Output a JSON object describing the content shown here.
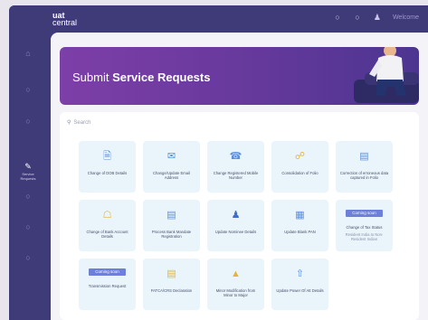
{
  "app": {
    "logo_line1": "uat",
    "logo_line2": "central",
    "user_name": "Welcome"
  },
  "sidebar": {
    "active_label": "Service Requests"
  },
  "banner": {
    "title_prefix": "Submit ",
    "title_bold": "Service Requests"
  },
  "search": {
    "placeholder": "Search"
  },
  "tiles": [
    {
      "label": "Change of DOB Details",
      "icon": "document-icon",
      "color": "#5a8fdc"
    },
    {
      "label": "Change/Update Email Address",
      "icon": "mail-icon",
      "color": "#4a8fd6"
    },
    {
      "label": "Change Registered Mobile Number",
      "icon": "phone-icon",
      "color": "#5a8fdc"
    },
    {
      "label": "Consolidation of Folio",
      "icon": "link-icon",
      "color": "#e3b53c"
    },
    {
      "label": "Correction of erroneous data captured in Folio",
      "icon": "form-icon",
      "color": "#5a8fdc"
    },
    {
      "label": "Change of Bank Account Details",
      "icon": "bank-icon",
      "color": "#e3b53c"
    },
    {
      "label": "Process Bank Mandate Registration",
      "icon": "clipboard-icon",
      "color": "#5a8fdc"
    },
    {
      "label": "Update Nominee Details",
      "icon": "people-icon",
      "color": "#3f6ec9"
    },
    {
      "label": "Update Blank PAN",
      "icon": "card-icon",
      "color": "#5a8fdc"
    },
    {
      "label": "Change of Tax Status",
      "icon": "tax-icon",
      "color": "#5a8fdc",
      "badge": "Coming soon",
      "sub": "Resident India to Non-Resident Indian"
    },
    {
      "label": "Transmission Request",
      "icon": "transfer-icon",
      "color": "#5a8fdc",
      "badge": "Coming soon"
    },
    {
      "label": "FATCA/CRS Declaration",
      "icon": "declaration-icon",
      "color": "#e3b53c"
    },
    {
      "label": "Minor Modification from Minor to Major",
      "icon": "user-upgrade-icon",
      "color": "#e3b53c"
    },
    {
      "label": "Update Power Of Att Details",
      "icon": "upload-icon",
      "color": "#5a8fdc"
    }
  ]
}
